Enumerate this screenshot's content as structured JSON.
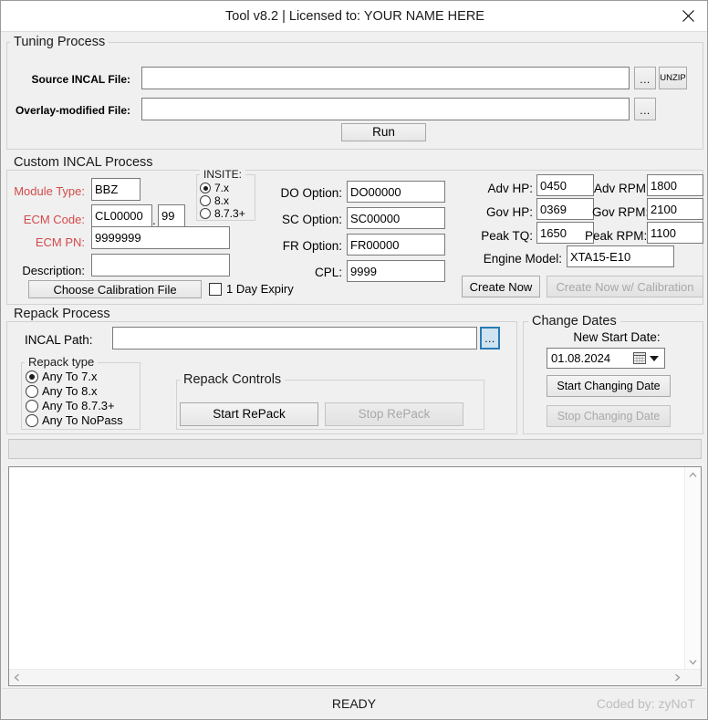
{
  "window": {
    "title": "Tool v8.2 | Licensed to: YOUR NAME HERE",
    "close_icon": "close-icon"
  },
  "tuning": {
    "group_title": "Tuning Process",
    "source_label": "Source INCAL File:",
    "source_value": "",
    "source_browse_label": "...",
    "unzip_label": "UNZIP",
    "overlay_label": "Overlay-modified File:",
    "overlay_value": "",
    "overlay_browse_label": "...",
    "run_label": "Run"
  },
  "custom": {
    "group_title": "Custom INCAL Process",
    "module_type_label": "Module Type:",
    "module_type_value": "BBZ",
    "ecm_code_label": "ECM Code:",
    "ecm_code_value": "CL00000",
    "ecm_code_dot": ".",
    "ecm_code_suffix": "99",
    "ecm_pn_label": "ECM PN:",
    "ecm_pn_value": "9999999",
    "description_label": "Description:",
    "description_value": "",
    "choose_cal_label": "Choose Calibration File",
    "expiry_label": "1 Day Expiry",
    "expiry_checked": false,
    "insite": {
      "group_title": "INSITE:",
      "options": [
        {
          "label": "7.x",
          "selected": true
        },
        {
          "label": "8.x",
          "selected": false
        },
        {
          "label": "8.7.3+",
          "selected": false
        }
      ]
    },
    "options": [
      {
        "label": "DO Option:",
        "value": "DO00000"
      },
      {
        "label": "SC Option:",
        "value": "SC00000"
      },
      {
        "label": "FR Option:",
        "value": "FR00000"
      },
      {
        "label": "CPL:",
        "value": "9999"
      }
    ],
    "specs": [
      {
        "label": "Adv HP:",
        "value": "0450"
      },
      {
        "label": "Gov HP:",
        "value": "0369"
      },
      {
        "label": "Peak TQ:",
        "value": "1650"
      }
    ],
    "specs_right": [
      {
        "label": "Adv RPM:",
        "value": "1800"
      },
      {
        "label": "Gov RPM:",
        "value": "2100"
      },
      {
        "label": "Peak RPM:",
        "value": "1100"
      }
    ],
    "engine_model_label": "Engine Model:",
    "engine_model_value": "XTA15-E10",
    "create_now_label": "Create Now",
    "create_now_cal_label": "Create Now w/ Calibration"
  },
  "repack": {
    "group_title": "Repack Process",
    "incal_path_label": "INCAL Path:",
    "incal_path_value": "",
    "incal_browse_label": "...",
    "type_group_title": "Repack type",
    "types": [
      {
        "label": "Any To 7.x",
        "selected": true
      },
      {
        "label": "Any To 8.x",
        "selected": false
      },
      {
        "label": "Any To 8.7.3+",
        "selected": false
      },
      {
        "label": "Any To NoPass",
        "selected": false
      }
    ],
    "controls_group_title": "Repack Controls",
    "start_label": "Start RePack",
    "stop_label": "Stop RePack"
  },
  "change_dates": {
    "group_title": "Change Dates",
    "new_start_date_label": "New Start Date:",
    "date_value": "01.08.2024",
    "calendar_icon": "calendar-icon",
    "dropdown_icon": "chevron-down-icon",
    "start_label": "Start Changing Date",
    "stop_label": "Stop Changing Date"
  },
  "progress": {
    "value": 0
  },
  "log": {
    "text": "",
    "scroll_up_icon": "chevron-up-icon",
    "scroll_down_icon": "chevron-down-icon",
    "scroll_left_icon": "chevron-left-icon",
    "scroll_right_icon": "chevron-right-icon"
  },
  "statusbar": {
    "status": "READY",
    "credit": "Coded by: zyNoT"
  },
  "colors": {
    "label_red": "#d34a4a",
    "focus_blue": "#2a7bb5",
    "credit_gray": "#bdbdbd"
  }
}
